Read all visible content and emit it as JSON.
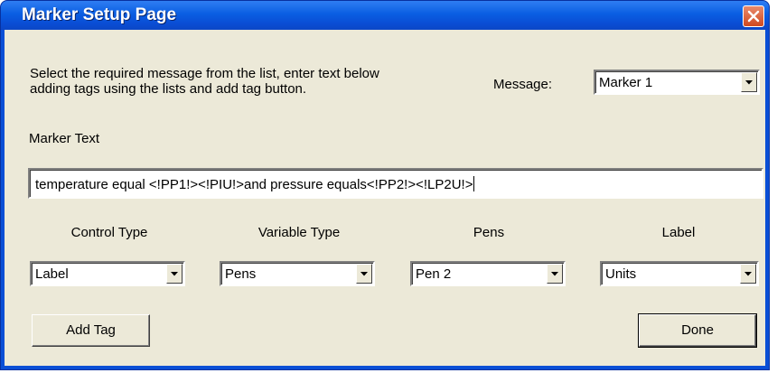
{
  "window": {
    "title": "Marker Setup Page"
  },
  "instructions": {
    "line1": "Select the required message from the list, enter text below",
    "line2": "adding tags using the lists and add tag button."
  },
  "message": {
    "label": "Message:",
    "value": "Marker 1"
  },
  "marker_text": {
    "label": "Marker Text",
    "value": "temperature equal <!PP1!><!PIU!>and pressure equals<!PP2!><!LP2U!>"
  },
  "selectors": [
    {
      "label": "Control Type",
      "value": "Label"
    },
    {
      "label": "Variable Type",
      "value": "Pens"
    },
    {
      "label": "Pens",
      "value": "Pen 2"
    },
    {
      "label": "Label",
      "value": "Units"
    }
  ],
  "buttons": {
    "add_tag": "Add Tag",
    "done": "Done"
  },
  "icons": {
    "close": "close-icon",
    "dropdown": "chevron-down-icon"
  },
  "colors": {
    "title_bar": "#0a4fd6",
    "close_button": "#d0491f",
    "dialog_face": "#ece9d8"
  }
}
